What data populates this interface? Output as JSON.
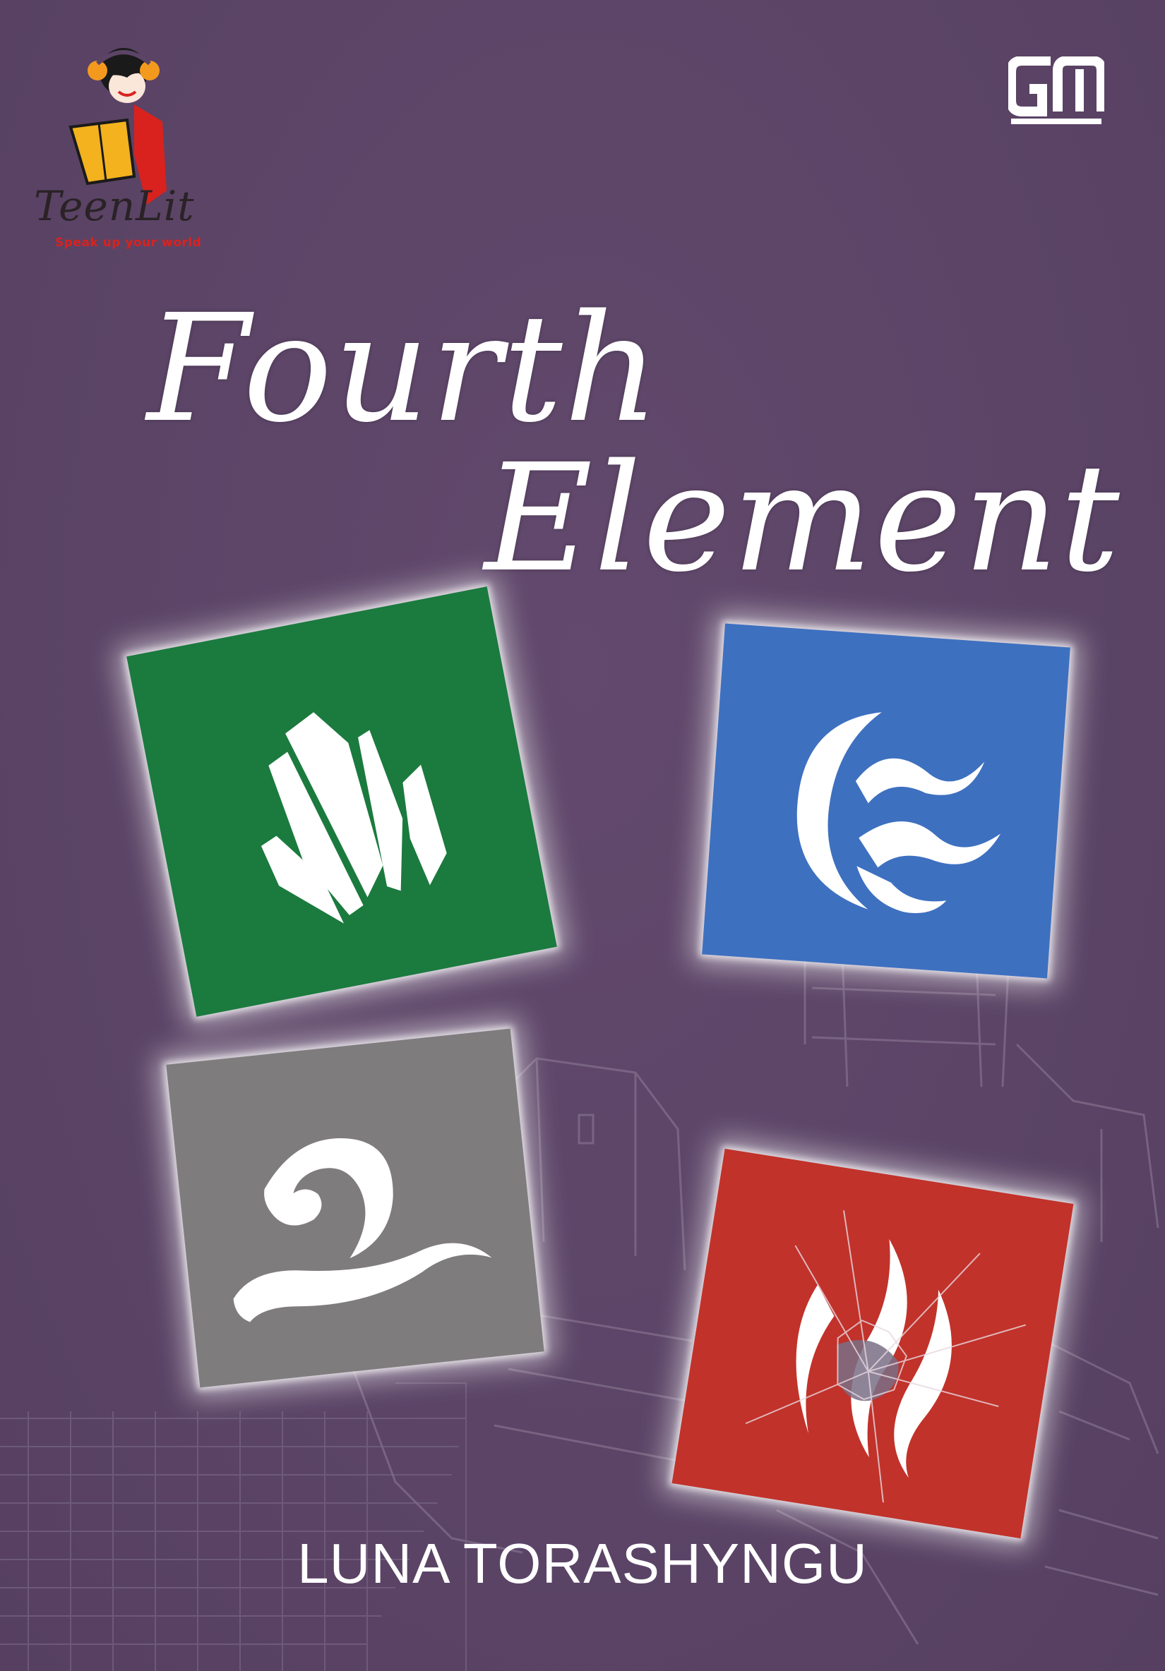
{
  "cover": {
    "title_line_1": "Fourth",
    "title_line_2": "Element",
    "author": "LUNA TORASHYNGU",
    "background_color": "#5d4668"
  },
  "imprint": {
    "name": "TeenLit",
    "tagline": "Speak up your world",
    "publisher_logo": "gm-logo"
  },
  "tiles": [
    {
      "element": "earth",
      "color": "#1b7a3e",
      "icon": "crystal-icon"
    },
    {
      "element": "water",
      "color": "#3e70c0",
      "icon": "wave-icon"
    },
    {
      "element": "air",
      "color": "#7f7c7d",
      "icon": "wind-swirl-icon"
    },
    {
      "element": "fire",
      "color": "#c1322a",
      "icon": "flame-icon"
    }
  ]
}
